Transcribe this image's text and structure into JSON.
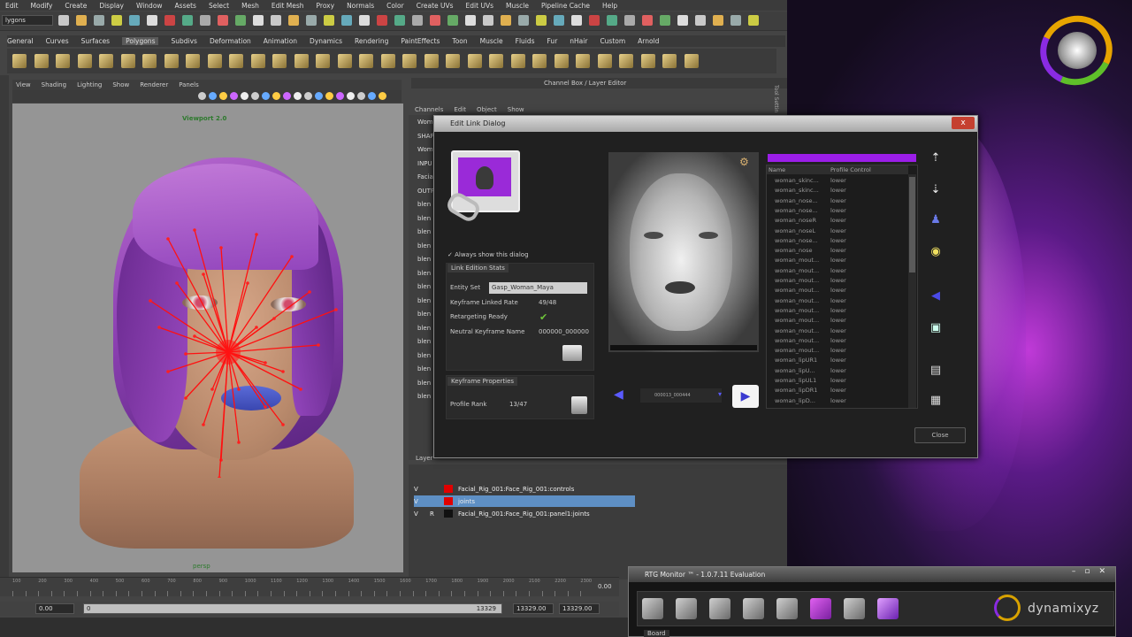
{
  "maya": {
    "menu": [
      "Edit",
      "Modify",
      "Create",
      "Display",
      "Window",
      "Assets",
      "Select",
      "Mesh",
      "Edit Mesh",
      "Proxy",
      "Normals",
      "Color",
      "Create UVs",
      "Edit UVs",
      "Muscle",
      "Pipeline Cache",
      "Help"
    ],
    "mode_dropdown": "lygons",
    "shelf_tabs": [
      "General",
      "Curves",
      "Surfaces",
      "Polygons",
      "Subdivs",
      "Deformation",
      "Animation",
      "Dynamics",
      "Rendering",
      "PaintEffects",
      "Toon",
      "Muscle",
      "Fluids",
      "Fur",
      "nHair",
      "Custom",
      "Arnold"
    ],
    "shelf_active": "Polygons",
    "viewport_menu": [
      "View",
      "Shading",
      "Lighting",
      "Show",
      "Renderer",
      "Panels"
    ],
    "viewport_label": "Viewport 2.0",
    "camera_label": "persp",
    "channel_box_title": "Channel Box / Layer Editor",
    "channel_menu": [
      "Channels",
      "Edit",
      "Object",
      "Show"
    ],
    "channel_rows": [
      "Wom",
      "SHAP",
      "Wom",
      "INPU",
      "Facial",
      "OUTP",
      "blen",
      "blen",
      "blen",
      "blen",
      "blen",
      "blen",
      "blen",
      "blen",
      "blen",
      "blen",
      "blen",
      "blen",
      "blen",
      "blen",
      "blen"
    ],
    "side_label": "Tool Settin",
    "layer_tab": "Layer",
    "layers": [
      {
        "v": "V",
        "p": "",
        "color": "#e00000",
        "name": "Facial_Rig_001:Face_Rig_001:controls",
        "selected": false
      },
      {
        "v": "V",
        "p": "",
        "color": "#e00000",
        "name": "joints",
        "selected": true
      },
      {
        "v": "V",
        "p": "R",
        "color": "#111111",
        "name": "Facial_Rig_001:Face_Rig_001:panel1:joints",
        "selected": false
      }
    ],
    "timeline_ticks": [
      "100",
      "150",
      "200",
      "250",
      "300",
      "350",
      "400",
      "450",
      "500",
      "550",
      "600",
      "650",
      "700",
      "750",
      "800",
      "850",
      "900",
      "950",
      "1000",
      "1050",
      "1100",
      "1150",
      "1200",
      "1250",
      "1300",
      "1350",
      "1400",
      "1450",
      "1500",
      "1550",
      "1600",
      "1650",
      "1700",
      "1750",
      "1800",
      "1850",
      "1900",
      "1950",
      "2000",
      "2050",
      "2100",
      "2150",
      "2200",
      "2250",
      "2300"
    ],
    "current_frame": "0.00",
    "range_start": "0.00",
    "range_field": "0",
    "range_mid": "13329",
    "range_end": "13329.00",
    "range_end2": "13329.00"
  },
  "dialog": {
    "title": "Edit Link Dialog",
    "close_glyph": "x",
    "always_show": "Always show this dialog",
    "link_section": "Link Edition Stats",
    "entity_set_label": "Entity Set",
    "entity_set_value": "Gasp_Woman_Maya",
    "linked_rate_label": "Keyframe Linked Rate",
    "linked_rate_value": "49/48",
    "retargeting_label": "Retargeting Ready",
    "neutral_label": "Neutral Keyframe Name",
    "neutral_value": "000000_000000",
    "keyframe_section": "Keyframe Properties",
    "profile_rank_label": "Profile Rank",
    "profile_rank_value": "13/47",
    "nav_field": "000013_000444",
    "list_headers": [
      "Name",
      "Profile Control"
    ],
    "list_rows": [
      [
        "woman_skinc...",
        "lower"
      ],
      [
        "woman_skinc...",
        "lower"
      ],
      [
        "woman_nose...",
        "lower"
      ],
      [
        "woman_nose...",
        "lower"
      ],
      [
        "woman_noseR",
        "lower"
      ],
      [
        "woman_noseL",
        "lower"
      ],
      [
        "woman_nose...",
        "lower"
      ],
      [
        "woman_nose",
        "lower"
      ],
      [
        "woman_mout...",
        "lower"
      ],
      [
        "woman_mout...",
        "lower"
      ],
      [
        "woman_mout...",
        "lower"
      ],
      [
        "woman_mout...",
        "lower"
      ],
      [
        "woman_mout...",
        "lower"
      ],
      [
        "woman_mout...",
        "lower"
      ],
      [
        "woman_mout...",
        "lower"
      ],
      [
        "woman_mout...",
        "lower"
      ],
      [
        "woman_mout...",
        "lower"
      ],
      [
        "woman_mout...",
        "lower"
      ],
      [
        "woman_lipUR1",
        "lower"
      ],
      [
        "woman_lipU...",
        "lower"
      ],
      [
        "woman_lipUL1",
        "lower"
      ],
      [
        "woman_lipDR1",
        "lower"
      ],
      [
        "woman_lipD...",
        "lower"
      ]
    ],
    "close_label": "Close",
    "accent": "#9b1ee8"
  },
  "rtg": {
    "title": "RTG Monitor ™ - 1.0.7.11 Evaluation",
    "window_controls": [
      "–",
      "▫",
      "✕"
    ],
    "brand": "dynamixyz",
    "tab": "Board"
  }
}
